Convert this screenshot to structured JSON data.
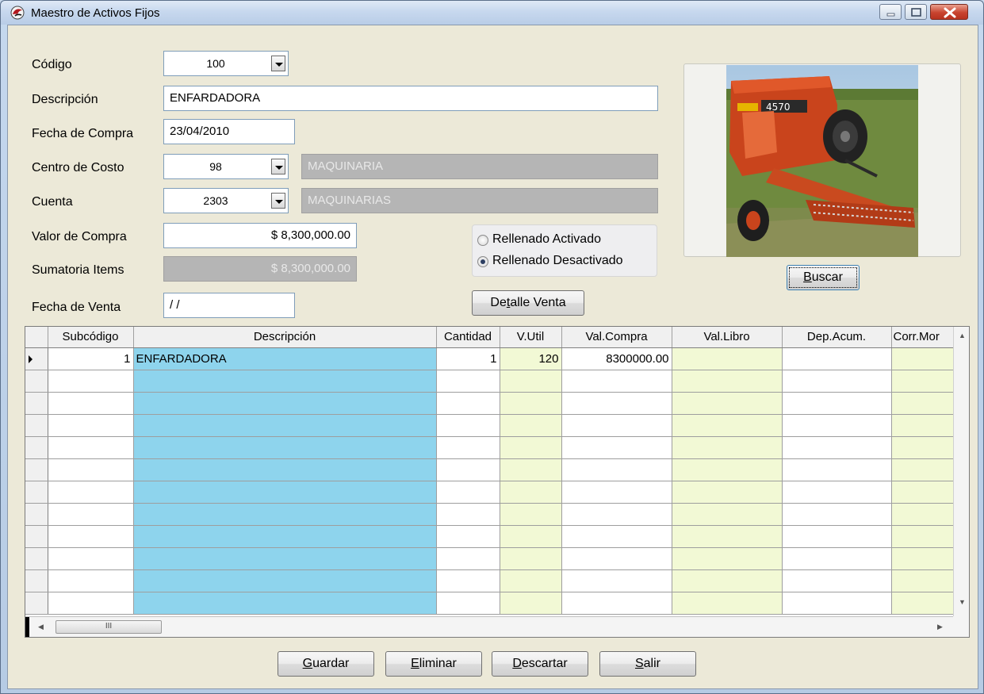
{
  "window": {
    "title": "Maestro de Activos Fijos"
  },
  "form": {
    "codigo_label": "Código",
    "codigo_value": "100",
    "descripcion_label": "Descripción",
    "descripcion_value": "ENFARDADORA",
    "fecha_compra_label": "Fecha de Compra",
    "fecha_compra_value": "23/04/2010",
    "centro_costo_label": "Centro de Costo",
    "centro_costo_code": "98",
    "centro_costo_name": "MAQUINARIA",
    "cuenta_label": "Cuenta",
    "cuenta_code": "2303",
    "cuenta_name": "MAQUINARIAS",
    "valor_compra_label": "Valor de Compra",
    "valor_compra_value": "$ 8,300,000.00",
    "sumatoria_label": "Sumatoria Items",
    "sumatoria_value": "$ 8,300,000.00",
    "fecha_venta_label": "Fecha de Venta",
    "fecha_venta_value": "/ /"
  },
  "rellenado": {
    "option_activado": "Rellenado Activado",
    "option_desactivado": "Rellenado Desactivado",
    "selected": "desactivado"
  },
  "buttons": {
    "buscar_prefix": "",
    "buscar_mnemonic": "B",
    "buscar_rest": "uscar",
    "detalle_prefix": "De",
    "detalle_mnemonic": "t",
    "detalle_rest": "alle Venta",
    "guardar_mnemonic": "G",
    "guardar_rest": "uardar",
    "eliminar_mnemonic": "E",
    "eliminar_rest": "liminar",
    "descartar_mnemonic": "D",
    "descartar_rest": "escartar",
    "salir_mnemonic": "S",
    "salir_rest": "alir"
  },
  "grid": {
    "columns": [
      "Subcódigo",
      "Descripción",
      "Cantidad",
      "V.Util",
      "Val.Compra",
      "Val.Libro",
      "Dep.Acum.",
      "Corr.Mor"
    ],
    "rows": [
      {
        "subcodigo": "1",
        "descripcion": "ENFARDADORA",
        "cantidad": "1",
        "vutil": "120",
        "valcompra": "8300000.00",
        "vallibro": "",
        "depacum": "",
        "corrmon": ""
      }
    ],
    "hscroll_thumb_glyph": "III"
  },
  "colors": {
    "description_column": "#8ed4ed",
    "computed_column": "#f2f9d5",
    "disabled_field": "#b5b5b5"
  },
  "icons": {
    "app_icon": "app-logo-icon",
    "minimize": "minimize-icon",
    "maximize": "maximize-icon",
    "close": "close-icon"
  }
}
